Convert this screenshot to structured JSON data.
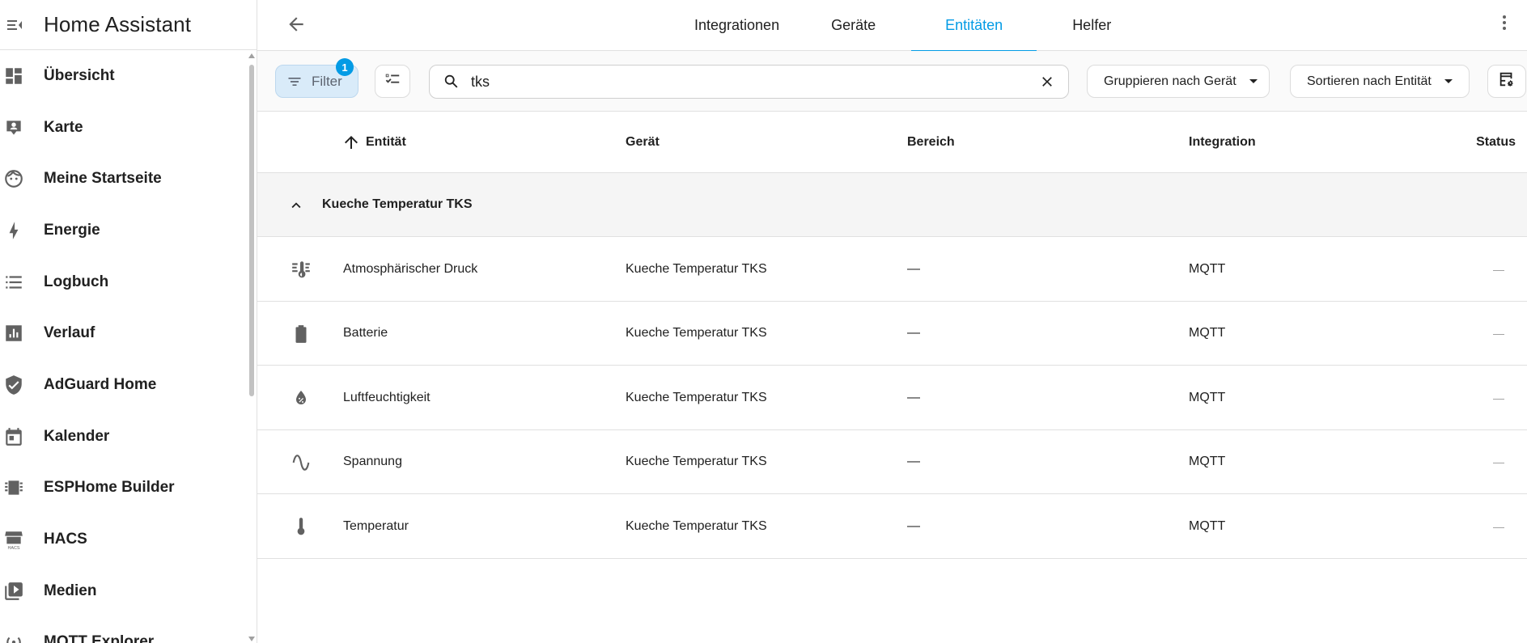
{
  "sidebar": {
    "title": "Home Assistant",
    "items": [
      {
        "label": "Übersicht",
        "icon": "dashboard-icon"
      },
      {
        "label": "Karte",
        "icon": "map-icon"
      },
      {
        "label": "Meine Startseite",
        "icon": "face-icon"
      },
      {
        "label": "Energie",
        "icon": "lightning-icon"
      },
      {
        "label": "Logbuch",
        "icon": "list-icon"
      },
      {
        "label": "Verlauf",
        "icon": "chart-icon"
      },
      {
        "label": "AdGuard Home",
        "icon": "shield-check-icon"
      },
      {
        "label": "Kalender",
        "icon": "calendar-icon"
      },
      {
        "label": "ESPHome Builder",
        "icon": "chip-icon"
      },
      {
        "label": "HACS",
        "icon": "hacs-icon"
      },
      {
        "label": "Medien",
        "icon": "media-icon"
      },
      {
        "label": "MQTT Explorer",
        "icon": "antenna-icon"
      }
    ]
  },
  "topbar": {
    "tabs": [
      {
        "label": "Integrationen",
        "active": false
      },
      {
        "label": "Geräte",
        "active": false
      },
      {
        "label": "Entitäten",
        "active": true
      },
      {
        "label": "Helfer",
        "active": false
      }
    ]
  },
  "toolbar": {
    "filter_label": "Filter",
    "filter_count": "1",
    "search_value": "tks",
    "group_by_label": "Gruppieren nach Gerät",
    "sort_by_label": "Sortieren nach Entität"
  },
  "table": {
    "columns": [
      "Entität",
      "Gerät",
      "Bereich",
      "Integration",
      "Status"
    ],
    "group": "Kueche Temperatur TKS",
    "rows": [
      {
        "icon": "thermometer-lines-icon",
        "entity": "Atmosphärischer Druck",
        "device": "Kueche Temperatur TKS",
        "area": "—",
        "integration": "MQTT",
        "status": "—"
      },
      {
        "icon": "battery-icon",
        "entity": "Batterie",
        "device": "Kueche Temperatur TKS",
        "area": "—",
        "integration": "MQTT",
        "status": "—"
      },
      {
        "icon": "water-percent-icon",
        "entity": "Luftfeuchtigkeit",
        "device": "Kueche Temperatur TKS",
        "area": "—",
        "integration": "MQTT",
        "status": "—"
      },
      {
        "icon": "sine-wave-icon",
        "entity": "Spannung",
        "device": "Kueche Temperatur TKS",
        "area": "—",
        "integration": "MQTT",
        "status": "—"
      },
      {
        "icon": "thermometer-icon",
        "entity": "Temperatur",
        "device": "Kueche Temperatur TKS",
        "area": "—",
        "integration": "MQTT",
        "status": "—"
      }
    ]
  },
  "colors": {
    "accent": "#039be5",
    "icon": "#616161",
    "filter_bg": "#d9ebf9"
  }
}
